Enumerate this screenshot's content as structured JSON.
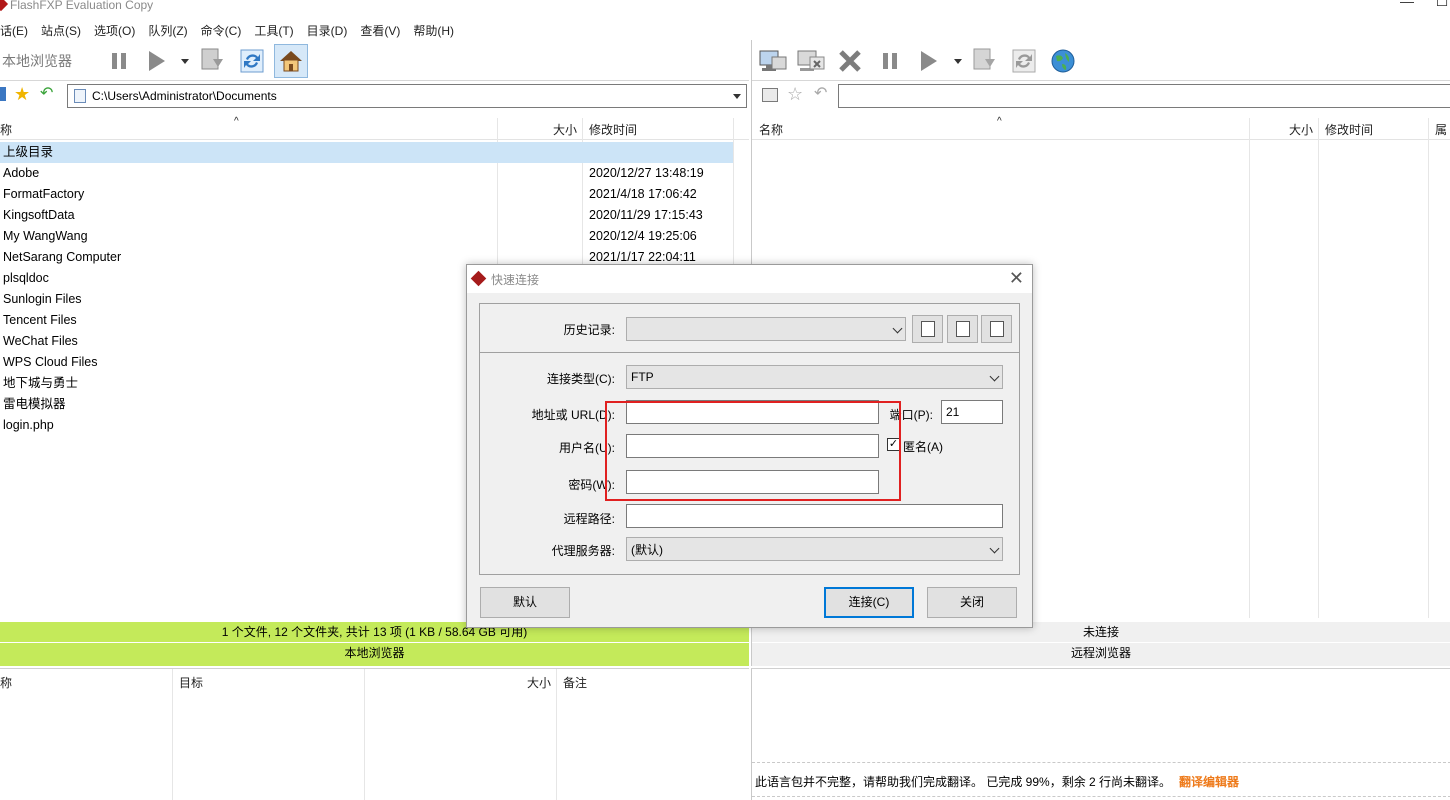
{
  "window": {
    "title": "FlashFXP Evaluation Copy",
    "minimize": "—",
    "maximize": "☐"
  },
  "menu": [
    "话(E)",
    "站点(S)",
    "选项(O)",
    "队列(Z)",
    "命令(C)",
    "工具(T)",
    "目录(D)",
    "查看(V)",
    "帮助(H)"
  ],
  "left": {
    "toolbar_label": "本地浏览器",
    "path": "C:\\Users\\Administrator\\Documents",
    "columns": {
      "name": "称",
      "size": "大小",
      "modified": "修改时间"
    },
    "files": [
      {
        "name": "上级目录",
        "date": ""
      },
      {
        "name": "Adobe",
        "date": "2020/12/27 13:48:19"
      },
      {
        "name": "FormatFactory",
        "date": "2021/4/18 17:06:42"
      },
      {
        "name": "KingsoftData",
        "date": "2020/11/29 17:15:43"
      },
      {
        "name": "My WangWang",
        "date": "2020/12/4 19:25:06"
      },
      {
        "name": "NetSarang Computer",
        "date": "2021/1/17 22:04:11"
      },
      {
        "name": "plsqldoc",
        "date": ""
      },
      {
        "name": "Sunlogin Files",
        "date": ""
      },
      {
        "name": "Tencent Files",
        "date": ""
      },
      {
        "name": "WeChat Files",
        "date": ""
      },
      {
        "name": "WPS Cloud Files",
        "date": ""
      },
      {
        "name": "地下城与勇士",
        "date": ""
      },
      {
        "name": "雷电模拟器",
        "date": ""
      },
      {
        "name": "login.php",
        "date": ""
      }
    ],
    "status": "1 个文件, 12 个文件夹, 共计 13 项 (1 KB / 58.64 GB 可用)",
    "status_label": "本地浏览器"
  },
  "right": {
    "columns": {
      "name": "名称",
      "size": "大小",
      "modified": "修改时间",
      "attr": "属"
    },
    "status": "未连接",
    "status_label": "远程浏览器"
  },
  "queue": {
    "columns": {
      "name": "称",
      "target": "目标",
      "size": "大小",
      "note": "备注"
    }
  },
  "log": {
    "message": "此语言包并不完整，请帮助我们完成翻译。 已完成 99%，剩余 2 行尚未翻译。",
    "link": "翻译编辑器"
  },
  "dialog": {
    "title": "快速连接",
    "history_label": "历史记录:",
    "history_value": "",
    "conn_type_label": "连接类型(C):",
    "conn_type_value": "FTP",
    "url_label": "地址或 URL(D):",
    "url_value": "",
    "port_label": "端口(P):",
    "port_value": "21",
    "user_label": "用户名(U):",
    "user_value": "",
    "anon_label": "匿名(A)",
    "anon_checked": "✓",
    "pass_label": "密码(W):",
    "pass_value": "",
    "remote_path_label": "远程路径:",
    "remote_path_value": "",
    "proxy_label": "代理服务器:",
    "proxy_value": "(默认)",
    "default_btn": "默认",
    "connect_btn": "连接(C)",
    "close_btn": "关闭"
  },
  "colors": {
    "status_green": "#c4ea5a",
    "highlight": "#e02020",
    "selected_row": "#cce4f7"
  }
}
